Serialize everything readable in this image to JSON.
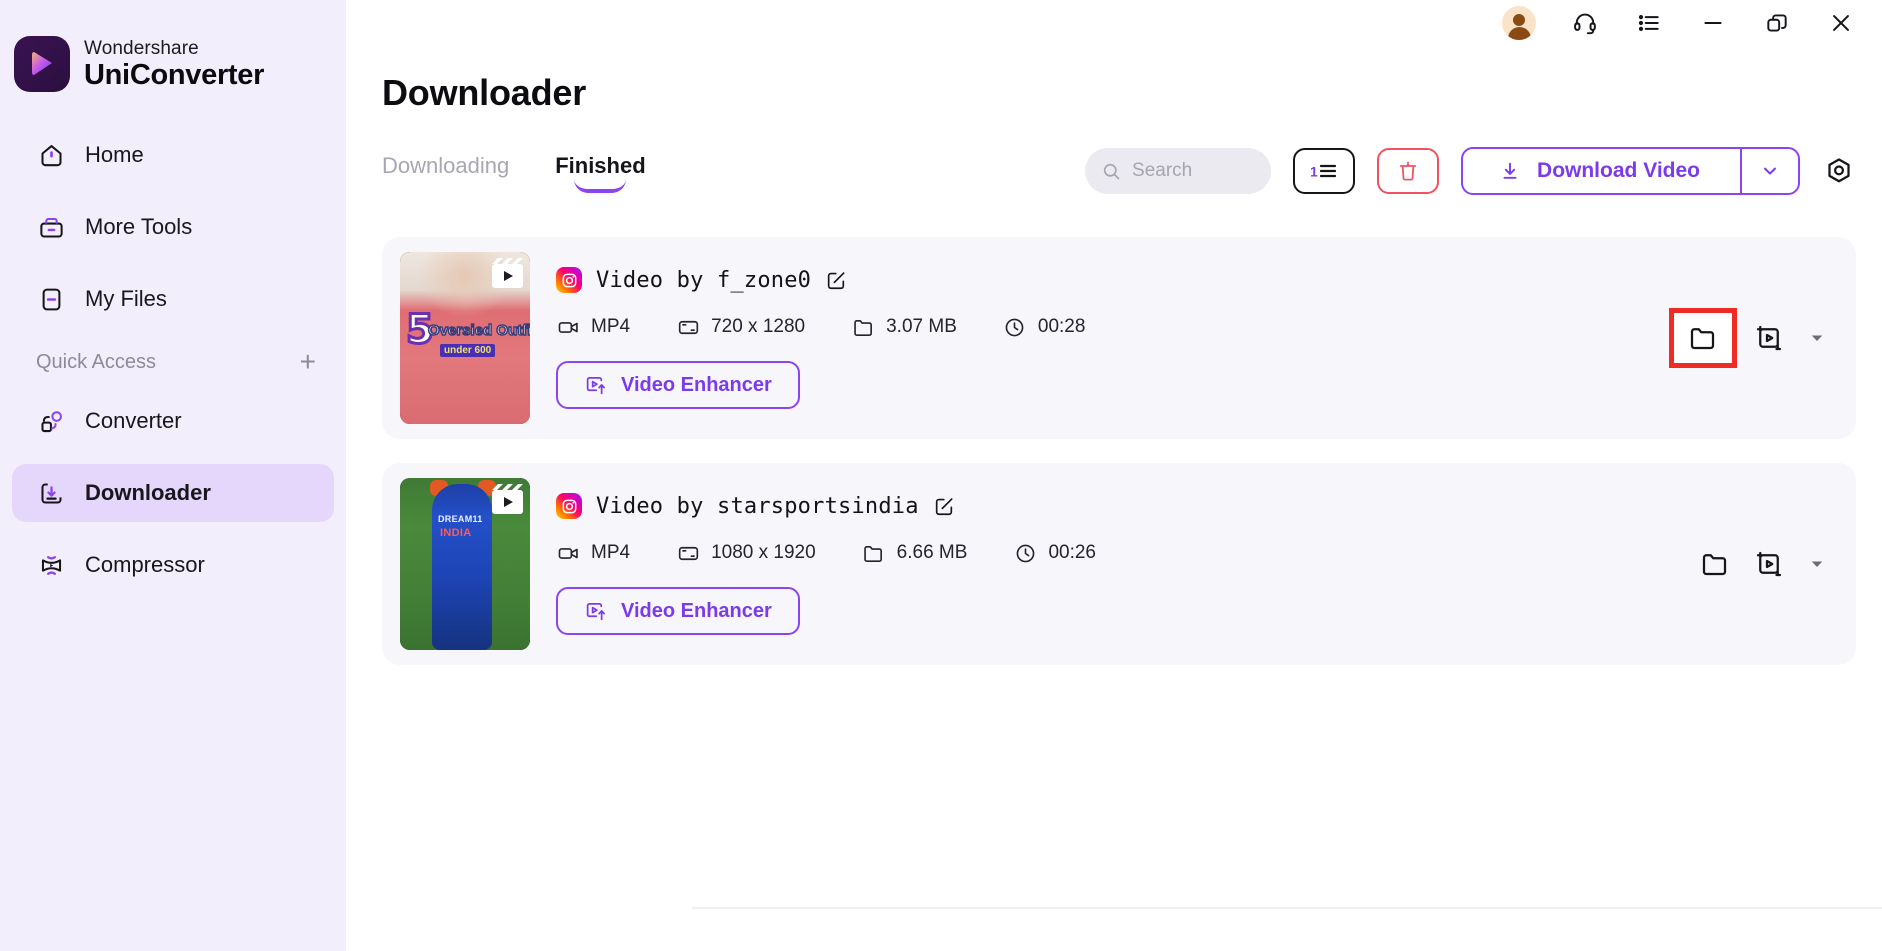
{
  "brand": {
    "line1": "Wondershare",
    "line2": "UniConverter",
    "logo_icon": "play-triangle-logo"
  },
  "sidebar": {
    "items": [
      {
        "label": "Home",
        "icon": "home-icon",
        "active": false
      },
      {
        "label": "More Tools",
        "icon": "toolbox-icon",
        "active": false
      },
      {
        "label": "My Files",
        "icon": "files-icon",
        "active": false
      }
    ],
    "quick_access": {
      "label": "Quick Access",
      "add_icon": "plus-icon"
    },
    "quick_items": [
      {
        "label": "Converter",
        "icon": "converter-icon",
        "active": false
      },
      {
        "label": "Downloader",
        "icon": "downloader-icon",
        "active": true
      },
      {
        "label": "Compressor",
        "icon": "compressor-icon",
        "active": false
      }
    ]
  },
  "titlebar": {
    "avatar": "user-avatar",
    "support": "headset-icon",
    "tasklist": "list-icon",
    "minimize": "minimize-icon",
    "restore": "restore-icon",
    "close": "close-icon"
  },
  "header": {
    "title": "Downloader"
  },
  "tabs": [
    {
      "label": "Downloading",
      "active": false
    },
    {
      "label": "Finished",
      "active": true
    }
  ],
  "toolbar": {
    "search": {
      "placeholder": "Search",
      "value": "",
      "icon": "search-icon"
    },
    "sort_button": {
      "icon": "sort-numeric-icon",
      "label": ""
    },
    "delete_button": {
      "icon": "trash-icon",
      "label": ""
    },
    "download_button": {
      "label": "Download Video",
      "icon": "download-icon",
      "caret": "chevron-down-icon"
    },
    "settings_button": {
      "icon": "gear-icon"
    }
  },
  "cards": [
    {
      "thumbnail": {
        "name": "video-thumbnail",
        "overlay_text_1": "5",
        "overlay_text_2": "Oversied Outfits",
        "overlay_text_3": "under 600",
        "badge": "reel-badge"
      },
      "source_icon": "instagram-icon",
      "title": "Video by f_zone0",
      "edit_icon": "edit-icon",
      "meta": [
        {
          "icon": "video-camera-icon",
          "value": "MP4"
        },
        {
          "icon": "resolution-icon",
          "value": "720 x 1280"
        },
        {
          "icon": "folder-icon",
          "value": "3.07 MB"
        },
        {
          "icon": "clock-icon",
          "value": "00:28"
        }
      ],
      "enhancer": {
        "label": "Video Enhancer",
        "icon": "video-enhance-icon"
      },
      "actions": {
        "open_folder": {
          "icon": "folder-icon",
          "highlighted": true
        },
        "convert": {
          "icon": "video-convert-icon",
          "highlighted": false
        },
        "more": {
          "icon": "caret-down-icon",
          "highlighted": false
        }
      }
    },
    {
      "thumbnail": {
        "name": "video-thumbnail",
        "overlay_text_1": "DREAM11",
        "overlay_text_2": "INDIA",
        "overlay_text_3": "",
        "badge": "reel-badge"
      },
      "source_icon": "instagram-icon",
      "title": "Video by starsportsindia",
      "edit_icon": "edit-icon",
      "meta": [
        {
          "icon": "video-camera-icon",
          "value": "MP4"
        },
        {
          "icon": "resolution-icon",
          "value": "1080 x 1920"
        },
        {
          "icon": "folder-icon",
          "value": "6.66 MB"
        },
        {
          "icon": "clock-icon",
          "value": "00:26"
        }
      ],
      "enhancer": {
        "label": "Video Enhancer",
        "icon": "video-enhance-icon"
      },
      "actions": {
        "open_folder": {
          "icon": "folder-icon",
          "highlighted": false
        },
        "convert": {
          "icon": "video-convert-icon",
          "highlighted": false
        },
        "more": {
          "icon": "caret-down-icon",
          "highlighted": false
        }
      }
    }
  ],
  "colors": {
    "accent": "#8b44ef",
    "accent_text": "#7b3bea",
    "sidebar_bg": "#f2eefb",
    "active_item_bg": "#e5d6fb",
    "card_bg": "#f7f6fb",
    "danger": "#f2525f",
    "highlight": "#ee2b24"
  }
}
